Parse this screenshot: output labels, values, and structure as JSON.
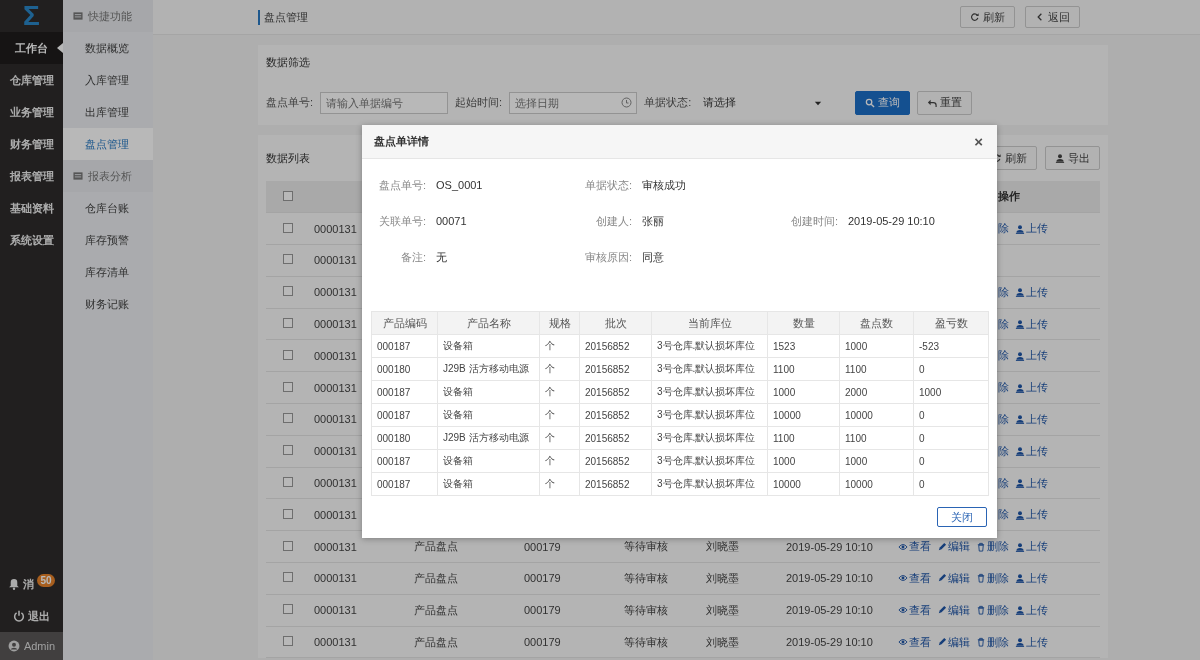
{
  "nav": {
    "logo": "Σ",
    "items": [
      {
        "label": "工作台",
        "selected": true
      },
      {
        "label": "仓库管理",
        "selected": false
      },
      {
        "label": "业务管理",
        "selected": false
      },
      {
        "label": "财务管理",
        "selected": false
      },
      {
        "label": "报表管理",
        "selected": false
      },
      {
        "label": "基础资料",
        "selected": false
      },
      {
        "label": "系统设置",
        "selected": false
      }
    ],
    "notifications": {
      "label": "消",
      "badge": "50"
    },
    "logout": "退出",
    "user": "Admin"
  },
  "subnav": {
    "groups": [
      {
        "title": "快捷功能",
        "items": [
          {
            "label": "数据概览",
            "selected": false
          },
          {
            "label": "入库管理",
            "selected": false
          },
          {
            "label": "出库管理",
            "selected": false
          },
          {
            "label": "盘点管理",
            "selected": true
          }
        ]
      },
      {
        "title": "报表分析",
        "items": [
          {
            "label": "仓库台账",
            "selected": false
          },
          {
            "label": "库存预警",
            "selected": false
          },
          {
            "label": "库存清单",
            "selected": false
          },
          {
            "label": "财务记账",
            "selected": false
          }
        ]
      }
    ]
  },
  "topbar": {
    "title": "盘点管理",
    "buttons": [
      "刷新",
      "返回"
    ]
  },
  "filter": {
    "title": "数据筛选",
    "fields": [
      {
        "kind": "text",
        "label": "盘点单号:",
        "placeholder": "请输入单据编号"
      },
      {
        "kind": "date",
        "label": "起始时间:",
        "placeholder": "选择日期"
      },
      {
        "kind": "select",
        "label": "单据状态:",
        "value": "请选择"
      }
    ],
    "buttons": [
      {
        "kind": "primary",
        "label": "查询"
      },
      {
        "kind": "default",
        "label": "重置"
      }
    ]
  },
  "list": {
    "title": "数据列表",
    "buttons": [
      "刷新",
      "导出"
    ],
    "header": {
      "checked": false,
      "actions_label": "操作"
    },
    "rows": [
      {
        "kind": "covered",
        "checked": false,
        "cells": [
          "0000131"
        ],
        "actions": [
          "除",
          "上传"
        ]
      },
      {
        "kind": "covered",
        "checked": false,
        "cells": [
          "0000131"
        ],
        "actions": []
      },
      {
        "kind": "covered",
        "checked": false,
        "cells": [
          "0000131"
        ],
        "actions": [
          "除",
          "上传"
        ]
      },
      {
        "kind": "covered",
        "checked": false,
        "cells": [
          "0000131"
        ],
        "actions": [
          "除",
          "上传"
        ]
      },
      {
        "kind": "covered",
        "checked": false,
        "cells": [
          "0000131"
        ],
        "actions": [
          "除",
          "上传"
        ]
      },
      {
        "kind": "covered",
        "checked": false,
        "cells": [
          "0000131"
        ],
        "actions": [
          "除",
          "上传"
        ]
      },
      {
        "kind": "covered",
        "checked": false,
        "cells": [
          "0000131"
        ],
        "actions": [
          "除",
          "上传"
        ]
      },
      {
        "kind": "covered",
        "checked": false,
        "cells": [
          "0000131"
        ],
        "actions": [
          "除",
          "上传"
        ]
      },
      {
        "kind": "covered",
        "checked": false,
        "cells": [
          "0000131"
        ],
        "actions": [
          "除",
          "上传"
        ]
      },
      {
        "kind": "covered",
        "checked": false,
        "cells": [
          "0000131"
        ],
        "actions": [
          "除",
          "上传"
        ]
      },
      {
        "kind": "full",
        "checked": false,
        "cells": [
          "0000131",
          "产品盘点",
          "000179",
          "等待审核",
          "刘晓墨",
          "2019-05-29 10:10"
        ],
        "actions": [
          "查看",
          "编辑",
          "删除",
          "上传"
        ]
      },
      {
        "kind": "full",
        "checked": false,
        "cells": [
          "0000131",
          "产品盘点",
          "000179",
          "等待审核",
          "刘晓墨",
          "2019-05-29 10:10"
        ],
        "actions": [
          "查看",
          "编辑",
          "删除",
          "上传"
        ]
      },
      {
        "kind": "full",
        "checked": false,
        "cells": [
          "0000131",
          "产品盘点",
          "000179",
          "等待审核",
          "刘晓墨",
          "2019-05-29 10:10"
        ],
        "actions": [
          "查看",
          "编辑",
          "删除",
          "上传"
        ]
      },
      {
        "kind": "full",
        "checked": false,
        "cells": [
          "0000131",
          "产品盘点",
          "000179",
          "等待审核",
          "刘晓墨",
          "2019-05-29 10:10"
        ],
        "actions": [
          "查看",
          "编辑",
          "删除",
          "上传"
        ]
      }
    ]
  },
  "modal": {
    "title": "盘点单详情",
    "close": "×",
    "fields": [
      [
        {
          "label": "盘点单号:",
          "value": "OS_0001"
        },
        {
          "label": "单据状态:",
          "value": "审核成功"
        }
      ],
      [
        {
          "label": "关联单号:",
          "value": "00071"
        },
        {
          "label": "创建人:",
          "value": "张丽"
        },
        {
          "label": "创建时间:",
          "value": "2019-05-29 10:10"
        }
      ],
      [
        {
          "label": "备注:",
          "value": "无"
        },
        {
          "label": "审核原因:",
          "value": "同意"
        }
      ]
    ],
    "table": {
      "columns": [
        "产品编码",
        "产品名称",
        "规格",
        "批次",
        "当前库位",
        "数量",
        "盘点数",
        "盈亏数"
      ],
      "rows": [
        [
          "000187",
          "设备箱",
          "个",
          "20156852",
          "3号仓库.默认损坏库位",
          "1523",
          "1000",
          "-523"
        ],
        [
          "000180",
          "J29B 活方移动电源",
          "个",
          "20156852",
          "3号仓库.默认损坏库位",
          "1100",
          "1100",
          "0"
        ],
        [
          "000187",
          "设备箱",
          "个",
          "20156852",
          "3号仓库.默认损坏库位",
          "1000",
          "2000",
          "1000"
        ],
        [
          "000187",
          "设备箱",
          "个",
          "20156852",
          "3号仓库.默认损坏库位",
          "10000",
          "10000",
          "0"
        ],
        [
          "000180",
          "J29B 活方移动电源",
          "个",
          "20156852",
          "3号仓库.默认损坏库位",
          "1100",
          "1100",
          "0"
        ],
        [
          "000187",
          "设备箱",
          "个",
          "20156852",
          "3号仓库.默认损坏库位",
          "1000",
          "1000",
          "0"
        ],
        [
          "000187",
          "设备箱",
          "个",
          "20156852",
          "3号仓库.默认损坏库位",
          "10000",
          "10000",
          "0"
        ]
      ]
    },
    "button": "关闭"
  }
}
